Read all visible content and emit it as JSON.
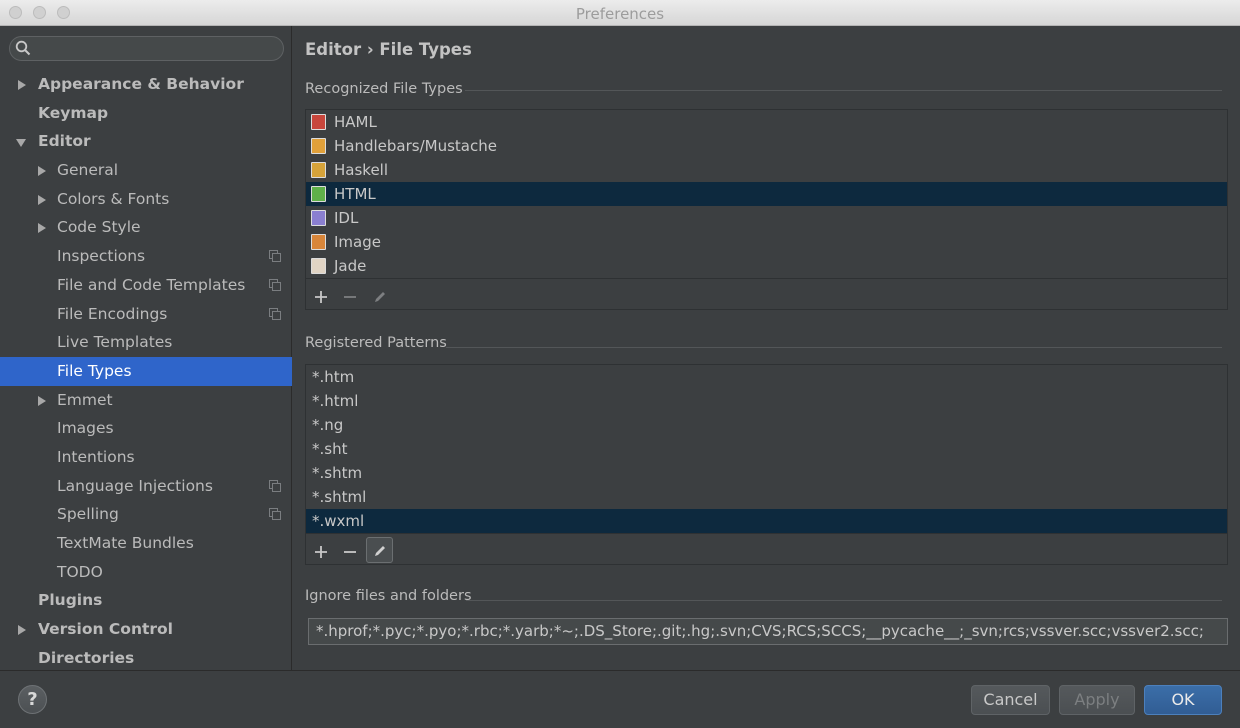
{
  "window": {
    "title": "Preferences"
  },
  "search": {
    "value": "",
    "placeholder": ""
  },
  "sidebar": {
    "items": [
      {
        "label": "Appearance & Behavior",
        "level": 0,
        "arrow": "right",
        "copy": false,
        "selected": false
      },
      {
        "label": "Keymap",
        "level": 0,
        "arrow": "none",
        "copy": false,
        "selected": false
      },
      {
        "label": "Editor",
        "level": 0,
        "arrow": "down",
        "copy": false,
        "selected": false
      },
      {
        "label": "General",
        "level": 1,
        "arrow": "right",
        "copy": false,
        "selected": false
      },
      {
        "label": "Colors & Fonts",
        "level": 1,
        "arrow": "right",
        "copy": false,
        "selected": false
      },
      {
        "label": "Code Style",
        "level": 1,
        "arrow": "right",
        "copy": false,
        "selected": false
      },
      {
        "label": "Inspections",
        "level": 1,
        "arrow": "none",
        "copy": true,
        "selected": false
      },
      {
        "label": "File and Code Templates",
        "level": 1,
        "arrow": "none",
        "copy": true,
        "selected": false
      },
      {
        "label": "File Encodings",
        "level": 1,
        "arrow": "none",
        "copy": true,
        "selected": false
      },
      {
        "label": "Live Templates",
        "level": 1,
        "arrow": "none",
        "copy": false,
        "selected": false
      },
      {
        "label": "File Types",
        "level": 1,
        "arrow": "none",
        "copy": false,
        "selected": true
      },
      {
        "label": "Emmet",
        "level": 1,
        "arrow": "right",
        "copy": false,
        "selected": false
      },
      {
        "label": "Images",
        "level": 1,
        "arrow": "none",
        "copy": false,
        "selected": false
      },
      {
        "label": "Intentions",
        "level": 1,
        "arrow": "none",
        "copy": false,
        "selected": false
      },
      {
        "label": "Language Injections",
        "level": 1,
        "arrow": "none",
        "copy": true,
        "selected": false
      },
      {
        "label": "Spelling",
        "level": 1,
        "arrow": "none",
        "copy": true,
        "selected": false
      },
      {
        "label": "TextMate Bundles",
        "level": 1,
        "arrow": "none",
        "copy": false,
        "selected": false
      },
      {
        "label": "TODO",
        "level": 1,
        "arrow": "none",
        "copy": false,
        "selected": false
      },
      {
        "label": "Plugins",
        "level": 0,
        "arrow": "none",
        "copy": false,
        "selected": false
      },
      {
        "label": "Version Control",
        "level": 0,
        "arrow": "right",
        "copy": false,
        "selected": false
      },
      {
        "label": "Directories",
        "level": 0,
        "arrow": "none",
        "copy": false,
        "selected": false
      }
    ]
  },
  "main": {
    "breadcrumb": "Editor › File Types",
    "recognized": {
      "label": "Recognized File Types",
      "items": [
        {
          "label": "HAML",
          "icon": "haml-file-icon",
          "color": "#c8463c",
          "selected": false
        },
        {
          "label": "Handlebars/Mustache",
          "icon": "handlebars-file-icon",
          "color": "#e0a03a",
          "selected": false
        },
        {
          "label": "Haskell",
          "icon": "haskell-file-icon",
          "color": "#d6a33a",
          "selected": false
        },
        {
          "label": "HTML",
          "icon": "html-file-icon",
          "color": "#5fb04a",
          "selected": true
        },
        {
          "label": "IDL",
          "icon": "idl-file-icon",
          "color": "#8a7fd0",
          "selected": false
        },
        {
          "label": "Image",
          "icon": "image-file-icon",
          "color": "#d8863a",
          "selected": false
        },
        {
          "label": "Jade",
          "icon": "jade-file-icon",
          "color": "#e0d4c4",
          "selected": false
        }
      ]
    },
    "patterns": {
      "label": "Registered Patterns",
      "items": [
        {
          "label": "*.htm",
          "selected": false
        },
        {
          "label": "*.html",
          "selected": false
        },
        {
          "label": "*.ng",
          "selected": false
        },
        {
          "label": "*.sht",
          "selected": false
        },
        {
          "label": "*.shtm",
          "selected": false
        },
        {
          "label": "*.shtml",
          "selected": false
        },
        {
          "label": "*.wxml",
          "selected": true
        }
      ]
    },
    "ignore": {
      "label": "Ignore files and folders",
      "value": "*.hprof;*.pyc;*.pyo;*.rbc;*.yarb;*~;.DS_Store;.git;.hg;.svn;CVS;RCS;SCCS;__pycache__;_svn;rcs;vssver.scc;vssver2.scc;"
    }
  },
  "footer": {
    "help_label": "?",
    "cancel_label": "Cancel",
    "apply_label": "Apply",
    "ok_label": "OK"
  },
  "colors": {
    "selection_sidebar": "#2f65ca",
    "selection_list": "#0d293e",
    "background": "#3c3f41"
  }
}
